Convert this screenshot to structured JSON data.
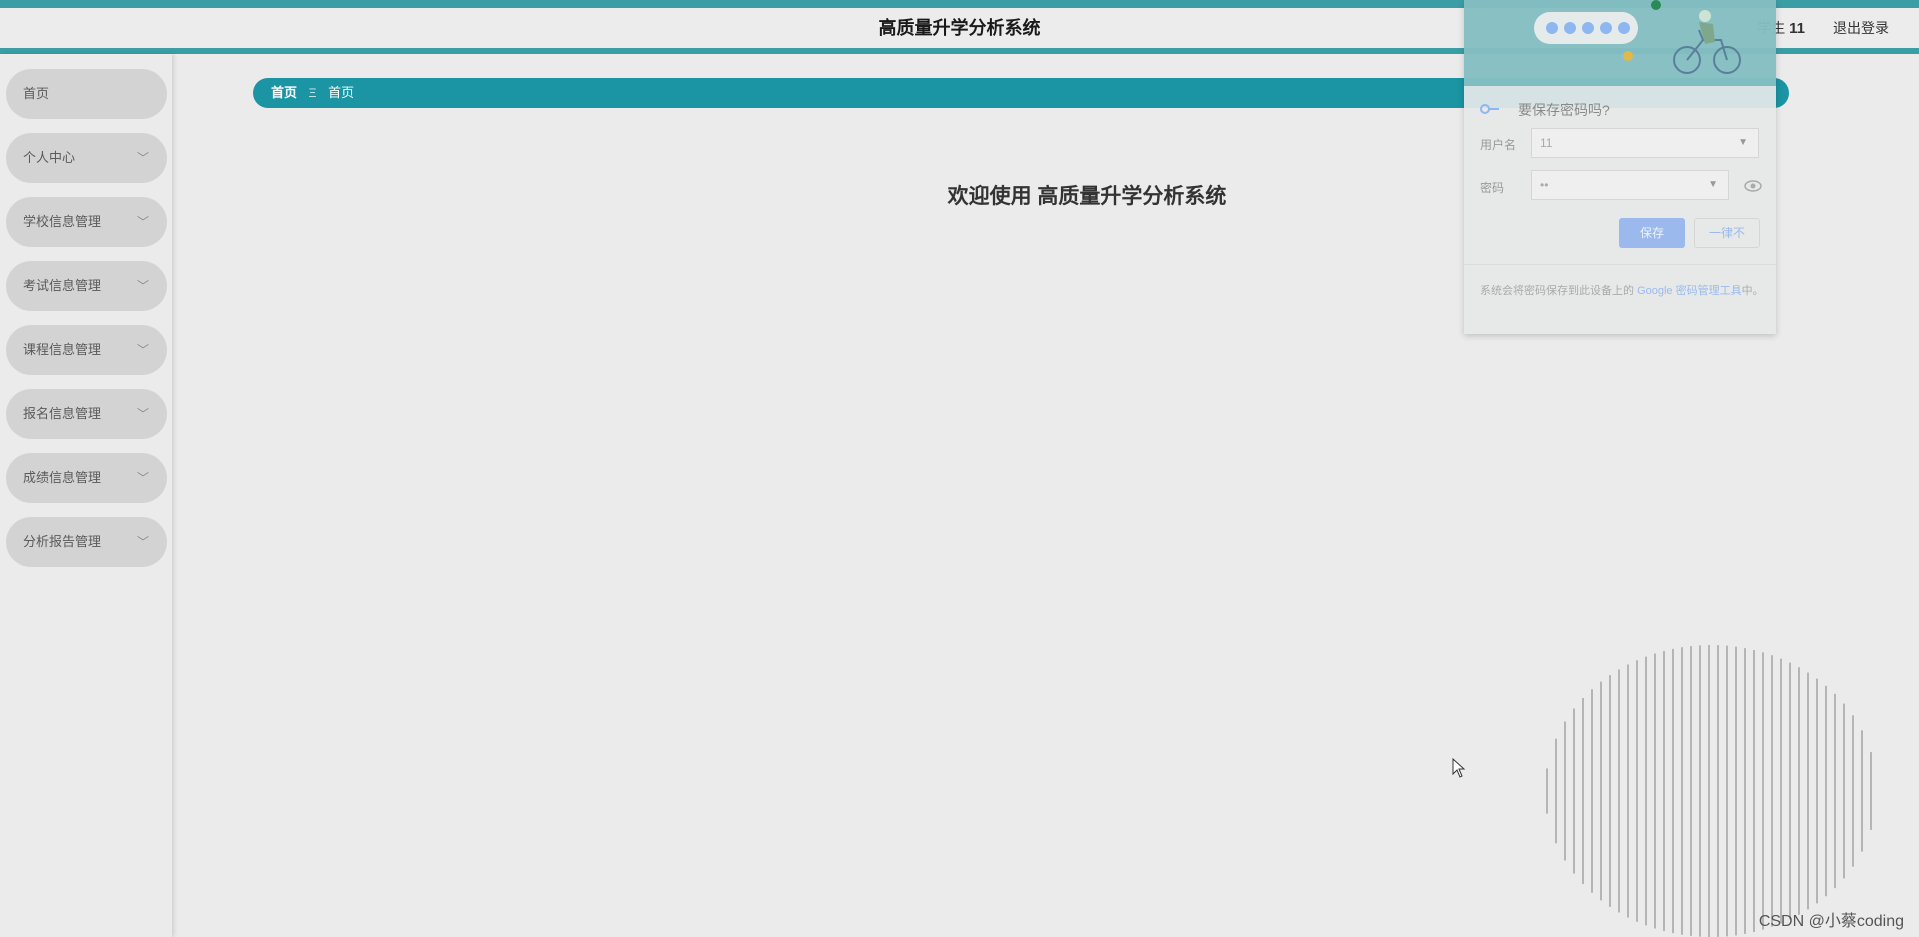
{
  "header": {
    "title": "高质量升学分析系统",
    "user_role": "学生",
    "user_name": "11",
    "logout_label": "退出登录"
  },
  "sidebar": {
    "items": [
      {
        "label": "首页",
        "icon": "none"
      },
      {
        "label": "个人中心",
        "icon": "chevron-down-icon"
      },
      {
        "label": "学校信息管理",
        "icon": "chevron-down-icon"
      },
      {
        "label": "考试信息管理",
        "icon": "chevron-down-icon"
      },
      {
        "label": "课程信息管理",
        "icon": "chevron-down-icon"
      },
      {
        "label": "报名信息管理",
        "icon": "chevron-down-icon"
      },
      {
        "label": "成绩信息管理",
        "icon": "chevron-down-icon"
      },
      {
        "label": "分析报告管理",
        "icon": "chevron-down-icon"
      }
    ]
  },
  "breadcrumb": {
    "items": [
      "首页",
      "首页"
    ],
    "separator": "Ξ"
  },
  "main": {
    "welcome_text": "欢迎使用 高质量升学分析系统"
  },
  "save_password_popup": {
    "title": "要保存密码吗?",
    "username_label": "用户名",
    "username_value": "11",
    "password_label": "密码",
    "password_value": "••",
    "save_label": "保存",
    "never_label": "一律不",
    "footer_text": "系统会将密码保存到此设备上的",
    "footer_link": "Google 密码管理工具",
    "footer_suffix": "中。"
  },
  "watermark": "CSDN @小蔡coding",
  "colors": {
    "accent": "#3b9ea4",
    "breadcrumb_bg": "#1b94a3",
    "menu_bg": "#d3d3d3",
    "page_bg": "#ebebeb"
  }
}
